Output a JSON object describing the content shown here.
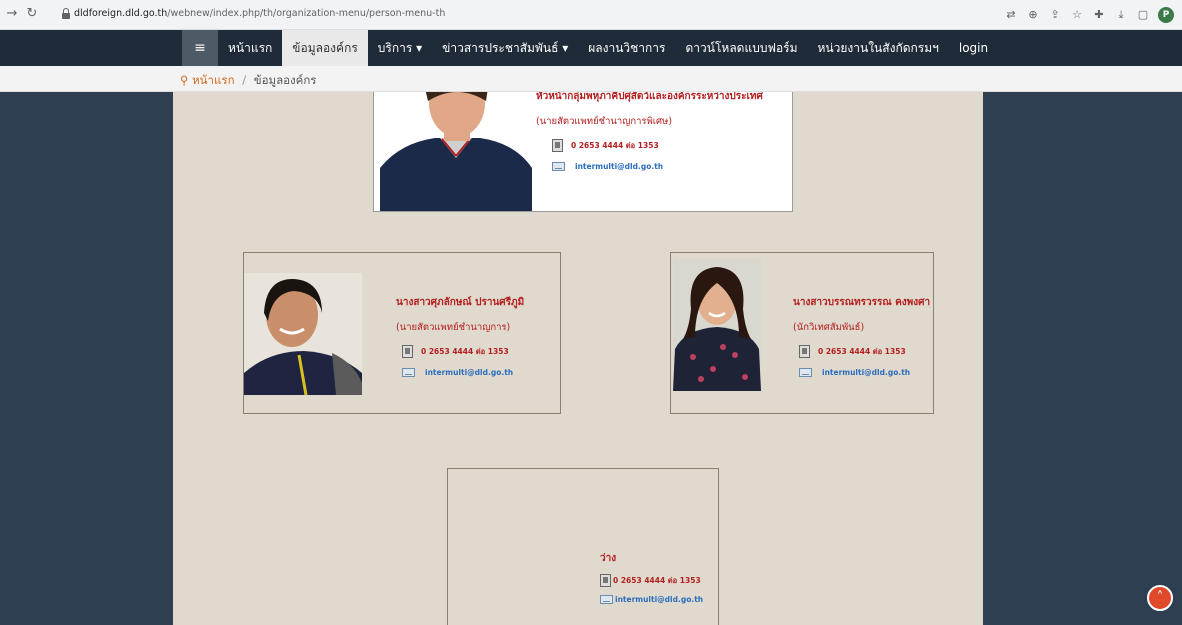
{
  "browser": {
    "url_domain": "dldforeign.dld.go.th",
    "url_path": "/webnew/index.php/th/organization-menu/person-menu-th",
    "profile_initial": "P"
  },
  "nav": {
    "items": [
      {
        "label": "หน้าแรก"
      },
      {
        "label": "ข้อมูลองค์กร"
      },
      {
        "label": "บริการ ▾"
      },
      {
        "label": "ข่าวสารประชาสัมพันธ์ ▾"
      },
      {
        "label": "ผลงานวิชาการ"
      },
      {
        "label": "ดาวน์โหลดแบบฟอร์ม"
      },
      {
        "label": "หน่วยงานในสังกัดกรมฯ"
      },
      {
        "label": "login"
      }
    ]
  },
  "breadcrumb": {
    "home": "หน้าแรก",
    "separator": "/",
    "current": "ข้อมูลองค์กร"
  },
  "people": [
    {
      "name": "หัวหน้ากลุ่มพหุภาคีปศุสัตว์และองค์กรระหว่างประเทศ",
      "position": "(นายสัตวแพทย์ชำนาญการพิเศษ)",
      "phone": "0 2653 4444 ต่อ 1353",
      "email": "intermulti@dld.go.th"
    },
    {
      "name": "นางสาวศุภลักษณ์ ปรานศรีภูมิ",
      "position": "(นายสัตวแพทย์ชำนาญการ)",
      "phone": "0 2653 4444 ต่อ 1353",
      "email": "intermulti@dld.go.th"
    },
    {
      "name": "นางสาวบรรณทรวรรณ คงพงศา",
      "position": "(นักวิเทศสัมพันธ์)",
      "phone": "0 2653 4444 ต่อ 1353",
      "email": "intermulti@dld.go.th"
    },
    {
      "name": "ว่าง",
      "phone": "0 2653 4444 ต่อ 1353",
      "email": "intermulti@dld.go.th"
    }
  ],
  "colors": {
    "page_bg": "#2e3f52",
    "content_bg": "#e0d9cd",
    "nav_bg": "#1f2b38",
    "name_red": "#b32020",
    "email_blue": "#2a6ebd"
  }
}
